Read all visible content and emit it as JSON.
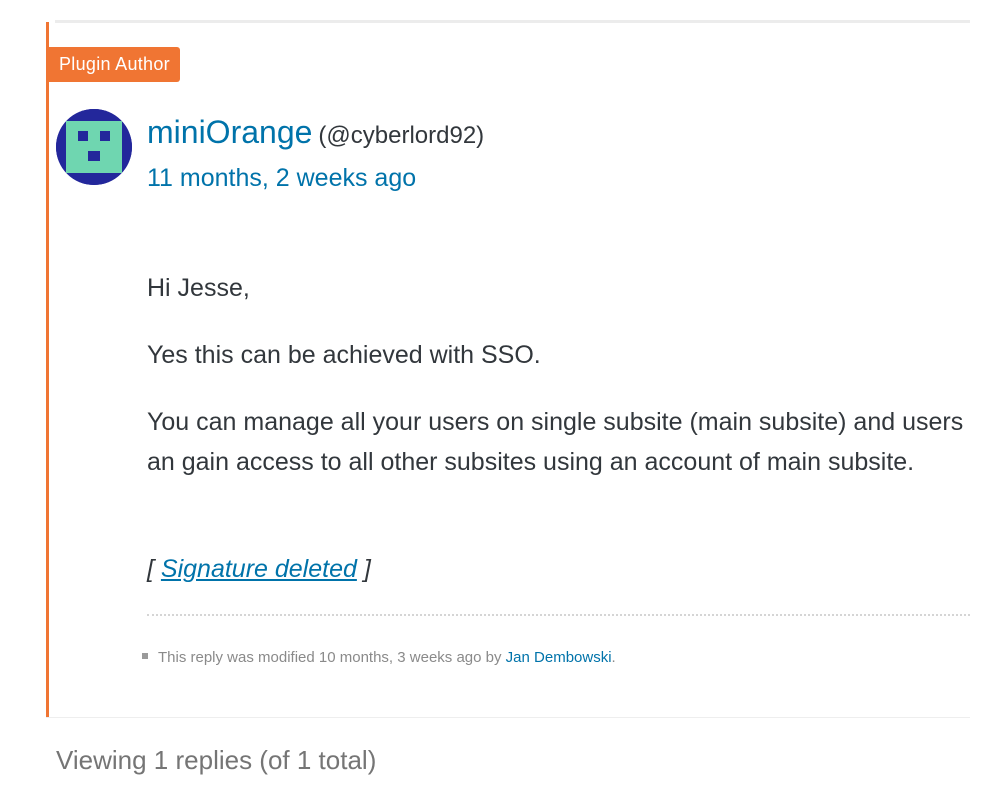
{
  "reply": {
    "badge": "Plugin Author",
    "author_name": "miniOrange",
    "author_handle": "(@cyberlord92)",
    "date": "11 months, 2 weeks ago",
    "paragraphs": {
      "greeting": "Hi Jesse,",
      "line2": "Yes this can be achieved with SSO.",
      "line3": "You can manage all your users on single subsite (main subsite) and users an gain access to all other subsites using an account of main subsite."
    },
    "signature": {
      "open": "[ ",
      "link": "Signature deleted",
      "close": " ]"
    },
    "modified": {
      "prefix": "This reply was modified 10 months, 3 weeks ago by ",
      "editor": "Jan Dembowski",
      "suffix": "."
    }
  },
  "footer": {
    "viewing": "Viewing 1 replies (of 1 total)"
  },
  "colors": {
    "accent": "#f07533",
    "link": "#0073aa",
    "avatar_bg": "#23279b",
    "avatar_fg": "#6fd6b0"
  },
  "icons": {
    "avatar": "identicon-avatar",
    "bullet": "square-bullet-icon"
  }
}
